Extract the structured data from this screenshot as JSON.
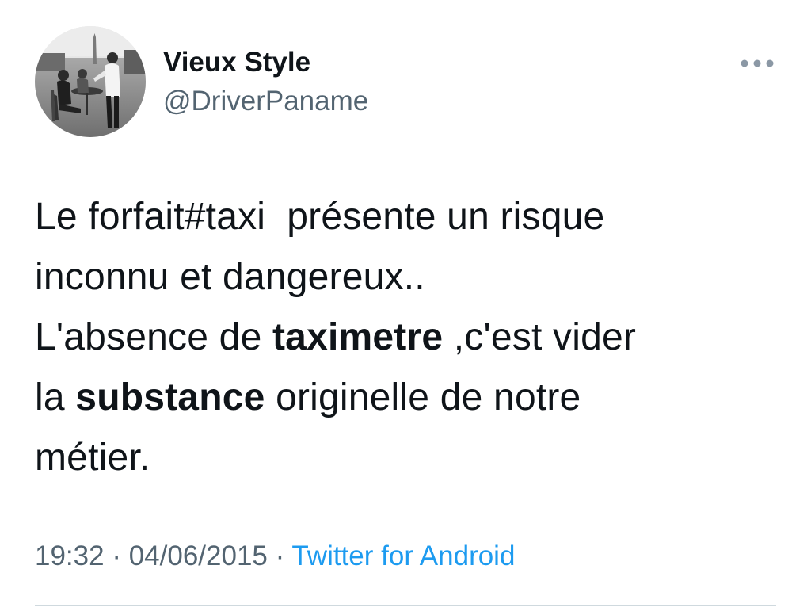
{
  "tweet": {
    "author": {
      "display_name": "Vieux Style",
      "handle": "@DriverPaname",
      "avatar": "avatar-photo-icon"
    },
    "more_icon": "more-horizontal-icon",
    "text_lines": [
      [
        "Le forfait#taxi  présente un risque"
      ],
      [
        "inconnu et dangereux.."
      ],
      [
        "L'absence de ",
        {
          "b": "taximetre"
        },
        " ,c'est vider"
      ],
      [
        "la ",
        {
          "b": "substance"
        },
        " originelle de notre"
      ],
      [
        "métier."
      ]
    ],
    "time": "19:32",
    "date": "04/06/2015",
    "separator": " · ",
    "source": "Twitter for Android"
  },
  "colors": {
    "text": "#0f1419",
    "secondary": "#536471",
    "link": "#1d9bf0",
    "divider": "#cfd9de"
  }
}
